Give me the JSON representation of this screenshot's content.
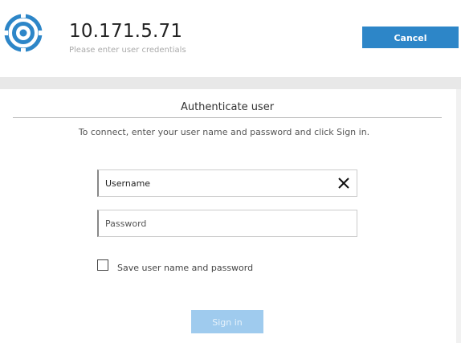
{
  "header": {
    "host": "10.171.5.71",
    "subtitle": "Please enter user credentials",
    "cancel_label": "Cancel",
    "logo_icon": "target-ring-icon",
    "accent_color": "#2d86c8"
  },
  "dialog": {
    "title": "Authenticate user",
    "instructions": "To connect, enter your user name and password and click Sign in."
  },
  "form": {
    "username": {
      "value": "Username",
      "clear_icon": "close-icon"
    },
    "password": {
      "value": "",
      "placeholder": "Password"
    },
    "save_checkbox": {
      "label": "Save user name and password",
      "checked": false
    },
    "signin_label": "Sign in",
    "signin_enabled": false
  }
}
